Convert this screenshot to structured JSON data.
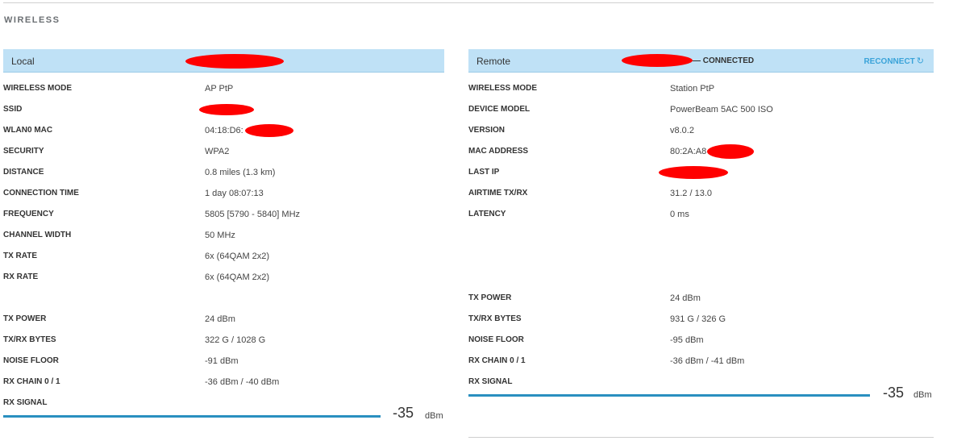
{
  "section_title": "WIRELESS",
  "colors": {
    "header_bg": "#bfe1f6",
    "accent": "#3aa3d9",
    "signal_bar": "#2a8fc0"
  },
  "local": {
    "header_label": "Local",
    "rows": [
      {
        "k": "WIRELESS MODE",
        "v": "AP PtP"
      },
      {
        "k": "SSID",
        "v": ""
      },
      {
        "k": "WLAN0 MAC",
        "v": "04:18:D6:"
      },
      {
        "k": "SECURITY",
        "v": "WPA2"
      },
      {
        "k": "DISTANCE",
        "v": "0.8 miles (1.3 km)"
      },
      {
        "k": "CONNECTION TIME",
        "v": "1 day 08:07:13"
      },
      {
        "k": "FREQUENCY",
        "v": "5805 [5790 - 5840] MHz"
      },
      {
        "k": "CHANNEL WIDTH",
        "v": "50 MHz"
      },
      {
        "k": "TX RATE",
        "v": "6x (64QAM 2x2)"
      },
      {
        "k": "RX RATE",
        "v": "6x (64QAM 2x2)"
      },
      {
        "k": "TX POWER",
        "v": "24 dBm"
      },
      {
        "k": "TX/RX BYTES",
        "v": "322 G / 1028 G"
      },
      {
        "k": "NOISE FLOOR",
        "v": "-91 dBm"
      },
      {
        "k": "RX CHAIN 0 / 1",
        "v": "-36 dBm / -40 dBm"
      },
      {
        "k": "RX SIGNAL",
        "v": ""
      }
    ],
    "rx_signal_value": "-35",
    "rx_signal_unit": "dBm"
  },
  "remote": {
    "header_label": "Remote",
    "status": "— CONNECTED",
    "reconnect_label": "RECONNECT",
    "reconnect_icon": "refresh-icon",
    "rows": [
      {
        "k": "WIRELESS MODE",
        "v": "Station PtP"
      },
      {
        "k": "DEVICE MODEL",
        "v": "PowerBeam 5AC 500 ISO"
      },
      {
        "k": "VERSION",
        "v": "v8.0.2"
      },
      {
        "k": "MAC ADDRESS",
        "v": "80:2A:A8"
      },
      {
        "k": "LAST IP",
        "v": ""
      },
      {
        "k": "AIRTIME TX/RX",
        "v": "31.2 / 13.0"
      },
      {
        "k": "LATENCY",
        "v": "0 ms"
      },
      {
        "k": "TX POWER",
        "v": "24 dBm"
      },
      {
        "k": "TX/RX BYTES",
        "v": "931 G / 326 G"
      },
      {
        "k": "NOISE FLOOR",
        "v": "-95 dBm"
      },
      {
        "k": "RX CHAIN 0 / 1",
        "v": "-36 dBm / -41 dBm"
      },
      {
        "k": "RX SIGNAL",
        "v": ""
      }
    ],
    "rx_signal_value": "-35",
    "rx_signal_unit": "dBm"
  }
}
